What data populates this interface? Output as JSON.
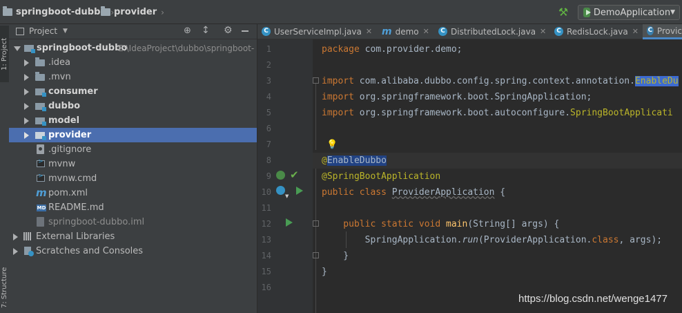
{
  "navbar": {
    "project": "springboot-dubbo",
    "module": "provider",
    "run_config": "DemoApplication"
  },
  "side_tabs": {
    "project": "1: Project",
    "structure": "7: Structure"
  },
  "project_panel": {
    "title": "Project",
    "items": [
      {
        "label": "springboot-dubbo",
        "path": "E:\\IdeaProject\\dubbo\\springboot-"
      },
      {
        "label": ".idea"
      },
      {
        "label": ".mvn"
      },
      {
        "label": "consumer"
      },
      {
        "label": "dubbo"
      },
      {
        "label": "model"
      },
      {
        "label": "provider"
      },
      {
        "label": ".gitignore"
      },
      {
        "label": "mvnw"
      },
      {
        "label": "mvnw.cmd"
      },
      {
        "label": "pom.xml"
      },
      {
        "label": "README.md"
      },
      {
        "label": "springboot-dubbo.iml"
      },
      {
        "label": "External Libraries"
      },
      {
        "label": "Scratches and Consoles"
      }
    ]
  },
  "editor_tabs": [
    {
      "label": "UserServiceImpl.java",
      "icon": "class-icon"
    },
    {
      "label": "demo",
      "icon": "maven-icon"
    },
    {
      "label": "DistributedLock.java",
      "icon": "class-icon"
    },
    {
      "label": "RedisLock.java",
      "icon": "class-icon"
    },
    {
      "label": "Provic",
      "icon": "springboot-class-icon"
    }
  ],
  "code": {
    "line_numbers": [
      "1",
      "2",
      "3",
      "4",
      "5",
      "6",
      "7",
      "8",
      "9",
      "10",
      "11",
      "12",
      "13",
      "14",
      "15",
      "16"
    ],
    "l1_kw": "package",
    "l1_rest": " com.provider.demo;",
    "l3_kw": "import",
    "l3_rest": " com.alibaba.dubbo.config.spring.context.annotation.",
    "l3_hl": "EnableDu",
    "l4_kw": "import",
    "l4_rest": " org.springframework.boot.SpringApplication;",
    "l5_kw": "import",
    "l5_rest": " org.springframework.boot.autoconfigure.",
    "l5_cls": "SpringBootApplicati",
    "l8_at": "@",
    "l8_hl": "EnableDubbo",
    "l9_ann": "@SpringBootApplication",
    "l10_kw": "public class",
    "l10_name": "ProviderApplication",
    "l10_rest": " {",
    "l12_kw": "    public static void",
    "l12_name": " main",
    "l12_rest": "(String[] args) {",
    "l13_a": "        SpringApplication.",
    "l13_run": "run",
    "l13_b": "(ProviderApplication.",
    "l13_kw": "class",
    "l13_c": ", args);",
    "l14": "    }",
    "l15": "}"
  },
  "watermark": "https://blog.csdn.net/wenge1477",
  "colors": {
    "keyword": "#cc7832",
    "annotation": "#bbb529",
    "selection": "#4b6eaf",
    "run_green": "#62b543"
  }
}
